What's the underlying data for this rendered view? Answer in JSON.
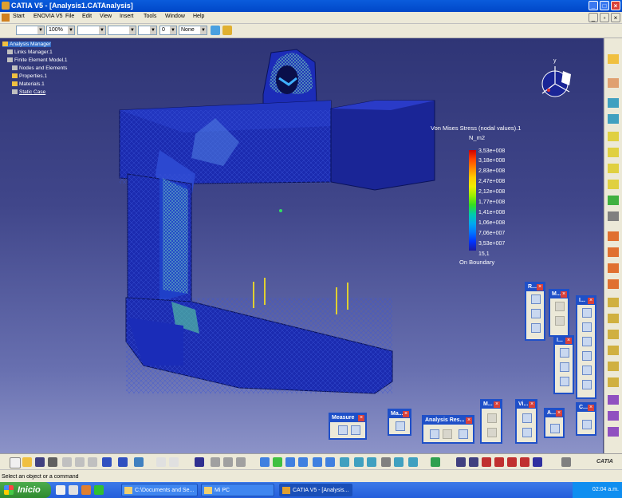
{
  "window": {
    "title": "CATIA V5 - [Analysis1.CATAnalysis]"
  },
  "menu": [
    "Start",
    "ENOVIA V5",
    "File",
    "Edit",
    "View",
    "Insert",
    "Tools",
    "Window",
    "Help"
  ],
  "toolbar": {
    "color_value": "",
    "zoom": "100%",
    "line_type": "",
    "thickness": "",
    "point_style": "",
    "layer_value": "0",
    "layer_filter": "None"
  },
  "tree": {
    "root": "Analysis Manager",
    "items": [
      "Links Manager.1",
      "Finite Element Model.1",
      "Nodes and Elements",
      "Properties.1",
      "Materials.1",
      "Static Case"
    ]
  },
  "legend": {
    "title": "Von Mises Stress (nodal values).1",
    "unit": "N_m2",
    "values": [
      "3,53e+008",
      "3,18e+008",
      "2,83e+008",
      "2,47e+008",
      "2,12e+008",
      "1,77e+008",
      "1,41e+008",
      "1,06e+008",
      "7,06e+007",
      "3,53e+007",
      "15,1"
    ],
    "footer": "On Boundary"
  },
  "compass": {
    "axis_label": "y"
  },
  "toolbars": {
    "measure": {
      "title": "Measure"
    },
    "ma": {
      "title": "Ma..."
    },
    "analysis_results": {
      "title": "Analysis Res..."
    },
    "m1": {
      "title": "M..."
    },
    "vi": {
      "title": "Vi..."
    },
    "a": {
      "title": "A..."
    },
    "c": {
      "title": "C..."
    },
    "r": {
      "title": "R..."
    },
    "m2": {
      "title": "M..."
    },
    "i1": {
      "title": "I..."
    },
    "i2": {
      "title": "I..."
    }
  },
  "brand": "CATIA",
  "status": {
    "prompt": "Select an object or a command"
  },
  "taskbar": {
    "start_label": "Inicio",
    "tasks": [
      "C:\\Documents and Se...",
      "Mi PC",
      "CATIA V5 - [Analysis..."
    ],
    "clock": "02:04 a.m."
  },
  "colors": {
    "title_bar": "#0047c8",
    "viewport_bg": "#3a4082",
    "part_body": "#1a2ab0",
    "mesh_highlight": "#5ad2a0"
  }
}
